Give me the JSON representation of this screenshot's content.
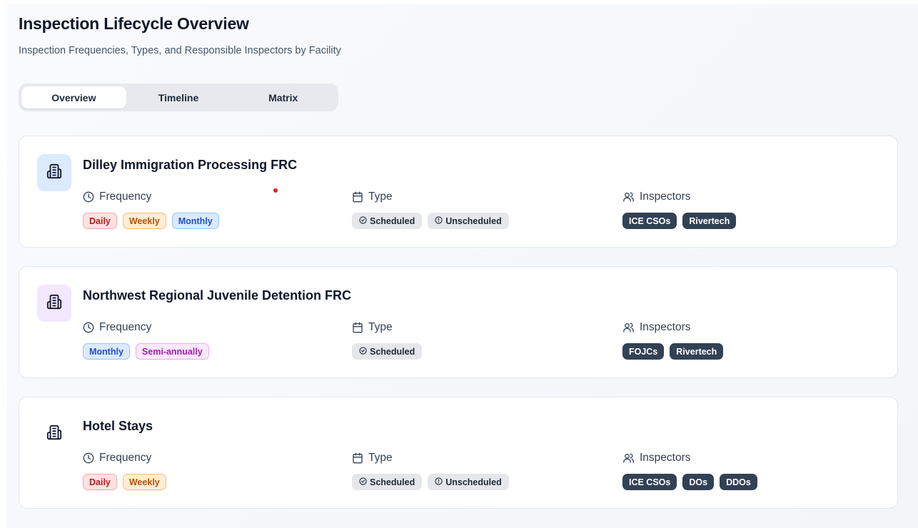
{
  "header": {
    "title": "Inspection Lifecycle Overview",
    "subtitle": "Inspection Frequencies, Types, and Responsible Inspectors by Facility"
  },
  "tabs": [
    {
      "label": "Overview",
      "active": true
    },
    {
      "label": "Timeline",
      "active": false
    },
    {
      "label": "Matrix",
      "active": false
    }
  ],
  "labels": {
    "frequency": "Frequency",
    "type": "Type",
    "inspectors": "Inspectors"
  },
  "colors": {
    "accent_dark": "#334155",
    "daily": "#b91c1c",
    "weekly": "#b45309",
    "monthly": "#1d4ed8",
    "semi_annually": "#a21caf"
  },
  "facilities": [
    {
      "name": "Dilley Immigration Processing FRC",
      "icon": "building-icon",
      "icon_bg": "#dbeafe",
      "frequency": [
        "Daily",
        "Weekly",
        "Monthly"
      ],
      "type": [
        "Scheduled",
        "Unscheduled"
      ],
      "inspectors": [
        "ICE CSOs",
        "Rivertech"
      ]
    },
    {
      "name": "Northwest Regional Juvenile Detention FRC",
      "icon": "building-icon",
      "icon_bg": "#f3e8ff",
      "frequency": [
        "Monthly",
        "Semi-annually"
      ],
      "type": [
        "Scheduled"
      ],
      "inspectors": [
        "FOJCs",
        "Rivertech"
      ]
    },
    {
      "name": "Hotel Stays",
      "icon": "building-icon",
      "icon_bg": "transparent",
      "frequency": [
        "Daily",
        "Weekly"
      ],
      "type": [
        "Scheduled",
        "Unscheduled"
      ],
      "inspectors": [
        "ICE CSOs",
        "DOs",
        "DDOs"
      ]
    }
  ]
}
